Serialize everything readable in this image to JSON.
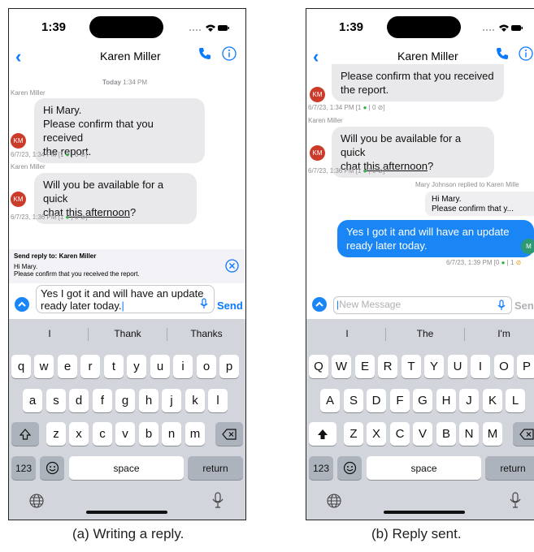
{
  "phone_a": {
    "status": {
      "time": "1:39"
    },
    "header": {
      "title": "Karen Miller",
      "back_icon": "chevron-left-icon",
      "call_icon": "phone-icon",
      "info_icon": "info-circle-icon"
    },
    "timestamp": {
      "day": "Today",
      "time": "1:34 PM"
    },
    "messages": [
      {
        "sender": "Karen Miller",
        "avatar": "KM",
        "lines": [
          "Hi Mary.",
          "Please confirm that you received",
          "the report."
        ],
        "meta_time": "6/7/23, 1:34 PM",
        "meta_rest": " [1 ",
        "meta_mid": " | 0 ",
        "meta_end": "]"
      },
      {
        "sender": "Karen Miller",
        "avatar": "KM",
        "line1": "Will you be available for a quick",
        "line2_pre": "chat ",
        "line2_u": "this afternoon",
        "line2_post": "?",
        "meta_time": "6/7/23, 1:36 PM",
        "meta_rest": " [1 ",
        "meta_mid": " | 0 ",
        "meta_end": "]"
      }
    ],
    "reply_panel": {
      "title": "Send reply to: Karen Miller",
      "line1": "Hi Mary.",
      "line2": "Please confirm that you received the report."
    },
    "composer": {
      "line1": "Yes I got it and will have an update",
      "line2": "ready later today.",
      "send_label": "Send"
    },
    "suggestions": [
      "I",
      "Thank",
      "Thanks"
    ],
    "keys": {
      "row1": [
        "q",
        "w",
        "e",
        "r",
        "t",
        "y",
        "u",
        "i",
        "o",
        "p"
      ],
      "row2": [
        "a",
        "s",
        "d",
        "f",
        "g",
        "h",
        "j",
        "k",
        "l"
      ],
      "row3": [
        "z",
        "x",
        "c",
        "v",
        "b",
        "n",
        "m"
      ],
      "num": "123",
      "space": "space",
      "return": "return"
    },
    "caption": "(a) Writing a reply."
  },
  "phone_b": {
    "status": {
      "time": "1:39"
    },
    "header": {
      "title": "Karen Miller"
    },
    "messages": [
      {
        "lines": [
          "Please confirm that you received",
          "the report."
        ],
        "avatar": "KM",
        "meta_time": "6/7/23, 1:34 PM",
        "meta_rest": " [1 ",
        "meta_mid": " | 0 ",
        "meta_end": "]"
      },
      {
        "sender": "Karen Miller",
        "avatar": "KM",
        "line1": "Will you be available for a quick",
        "line2_pre": "chat ",
        "line2_u": "this afternoon",
        "line2_post": "?",
        "meta_time": "6/7/23, 1:36 PM",
        "meta_rest": " [1 ",
        "meta_mid": " | 0 ",
        "meta_end": "]"
      }
    ],
    "reply_note": "Mary Johnson replied to Karen Mille",
    "quoted": {
      "line1": "Hi Mary.",
      "line2": "Please confirm that y..."
    },
    "my_message": {
      "line1": "Yes I got it and will have an update",
      "line2": "ready later today.",
      "avatar": "M",
      "meta_time": "6/7/23, 1:39 PM",
      "meta_rest": " [0 ",
      "meta_mid": " | 1 "
    },
    "composer": {
      "placeholder": "New Message",
      "send_label": "Send"
    },
    "suggestions": [
      "I",
      "The",
      "I'm"
    ],
    "keys": {
      "row1": [
        "Q",
        "W",
        "E",
        "R",
        "T",
        "Y",
        "U",
        "I",
        "O",
        "P"
      ],
      "row2": [
        "A",
        "S",
        "D",
        "F",
        "G",
        "H",
        "J",
        "K",
        "L"
      ],
      "row3": [
        "Z",
        "X",
        "C",
        "V",
        "B",
        "N",
        "M"
      ],
      "num": "123",
      "space": "space",
      "return": "return"
    },
    "caption": "(b) Reply sent."
  },
  "colors": {
    "accent": "#0a7aff",
    "bubble_sent": "#1a86f5",
    "avatar_km": "#cc3a2a",
    "avatar_m": "#2e9a73",
    "eye": "#2fb344"
  }
}
